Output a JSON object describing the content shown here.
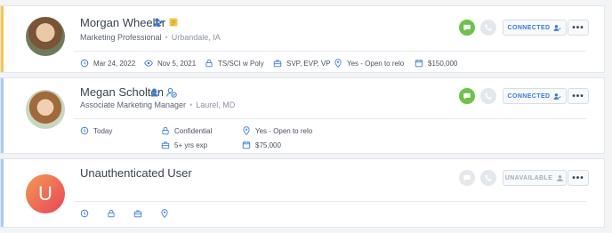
{
  "candidates": [
    {
      "name": "Morgan Wheeler",
      "title": "Marketing Professional",
      "location": "Urbandale, IA",
      "accent_color": "#f5c84c",
      "status_label": "CONNECTED",
      "more_label": "•••",
      "meta": {
        "updated": "Mar 24, 2022",
        "viewed": "Nov 5, 2021",
        "clearance": "TS/SCI w Poly",
        "level": "SVP, EVP, VP",
        "relocation": "Yes - Open to relo",
        "salary": "$150,000"
      }
    },
    {
      "name": "Megan Scholten",
      "title": "Associate Marketing Manager",
      "location": "Laurel, MD",
      "accent_color": "#a9cdef",
      "status_label": "CONNECTED",
      "more_label": "•••",
      "meta": {
        "availability": "Today",
        "clearance": "Confidential",
        "relocation": "Yes - Open to relo",
        "experience": "5+ yrs exp",
        "salary": "$75,000"
      }
    },
    {
      "name": "Unauthenticated User",
      "avatar_letter": "U",
      "accent_color": "#a9cdef",
      "status_label": "UNAVAILABLE",
      "more_label": "•••"
    }
  ],
  "colors": {
    "connected_blue": "#3a7bd5",
    "message_green": "#6cc24a",
    "disabled_gray": "#e4e7eb",
    "unavailable_text": "#a5acb6"
  }
}
